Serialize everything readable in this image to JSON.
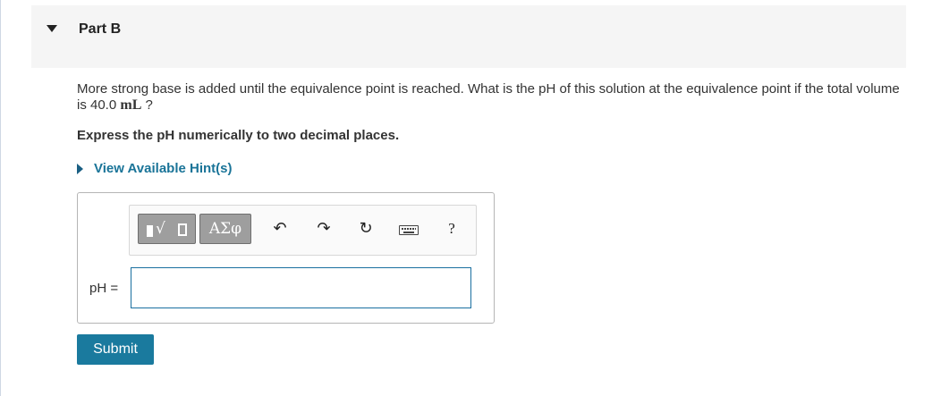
{
  "part": {
    "title": "Part B"
  },
  "question": {
    "text_before_unit": "More strong base is added until the equivalence point is reached. What is the pH of this solution at the equivalence point if the total volume is 40.0 ",
    "unit": "mL",
    "text_after_unit": " ?"
  },
  "instruction": "Express the pH numerically to two decimal places.",
  "hints": {
    "label": "View Available Hint(s)"
  },
  "toolbar": {
    "symbols_label": "ΑΣφ",
    "undo_glyph": "↶",
    "redo_glyph": "↷",
    "reset_glyph": "↻",
    "help_label": "?"
  },
  "answer": {
    "label": "pH =",
    "value": "",
    "placeholder": ""
  },
  "submit": {
    "label": "Submit"
  },
  "icons": [
    "collapse-triangle-icon",
    "hint-expand-icon",
    "templates-icon",
    "undo-icon",
    "redo-icon",
    "reset-icon",
    "keyboard-icon",
    "help-icon"
  ],
  "colors": {
    "link": "#1a7498",
    "submit_bg": "#1a7a9e",
    "input_border": "#1a6fa0",
    "header_bg": "#f5f5f5"
  }
}
